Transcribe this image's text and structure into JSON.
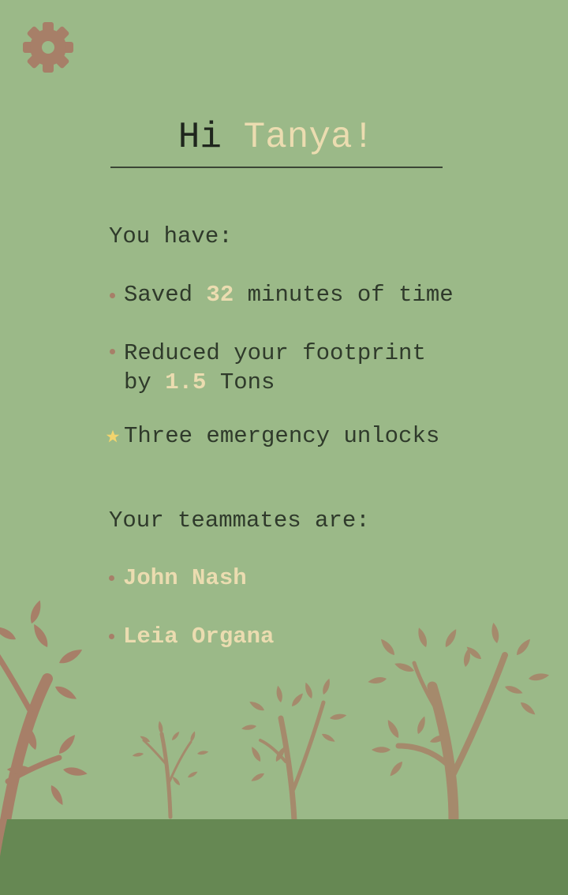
{
  "header": {
    "settings_icon": "gear-icon"
  },
  "greeting": {
    "prefix": "Hi",
    "name": "Tanya!"
  },
  "stats": {
    "heading": "You have:",
    "saved": {
      "before": "Saved ",
      "value": "32",
      "after": " minutes of time"
    },
    "footprint": {
      "line1": "Reduced your footprint",
      "before": "by ",
      "value": "1.5",
      "after": " Tons"
    },
    "unlocks": {
      "icon": "star-icon",
      "text": "Three emergency unlocks"
    }
  },
  "team": {
    "heading": "Your teammates are:",
    "members": [
      "John Nash",
      "Leia Organa"
    ]
  },
  "colors": {
    "background": "#9bb988",
    "ground": "#668853",
    "accent": "#ebdcb0",
    "tree": "#a77f68",
    "star": "#f2d46d"
  }
}
